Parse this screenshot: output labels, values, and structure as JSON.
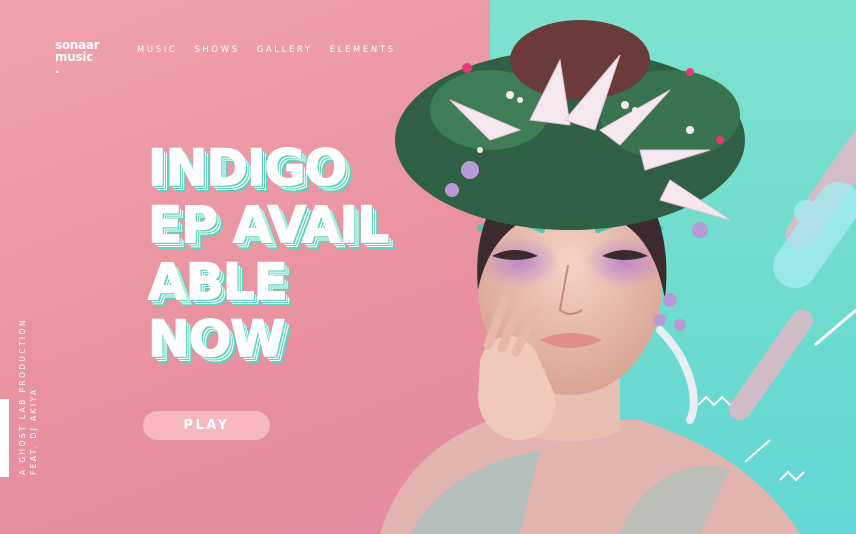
{
  "brand": {
    "line1": "sonaar",
    "line2": "music",
    "dot": "."
  },
  "nav": {
    "items": [
      {
        "label": "MUSIC"
      },
      {
        "label": "SHOWS"
      },
      {
        "label": "GALLERY"
      },
      {
        "label": "ELEMENTS"
      }
    ]
  },
  "hero": {
    "lines": [
      "INDIGO",
      "EP AVAIL",
      "ABLE",
      "NOW"
    ],
    "play_label": "PLAY"
  },
  "side": {
    "line1": "A GHOST LAB PRODUCTION",
    "line2": "FEAT. DJ AKIYA"
  },
  "colors": {
    "pink": "#eb9aa6",
    "teal": "#6fdccd",
    "headline_shadow": "#5fd3bb",
    "play_button": "#f7b8c0"
  }
}
